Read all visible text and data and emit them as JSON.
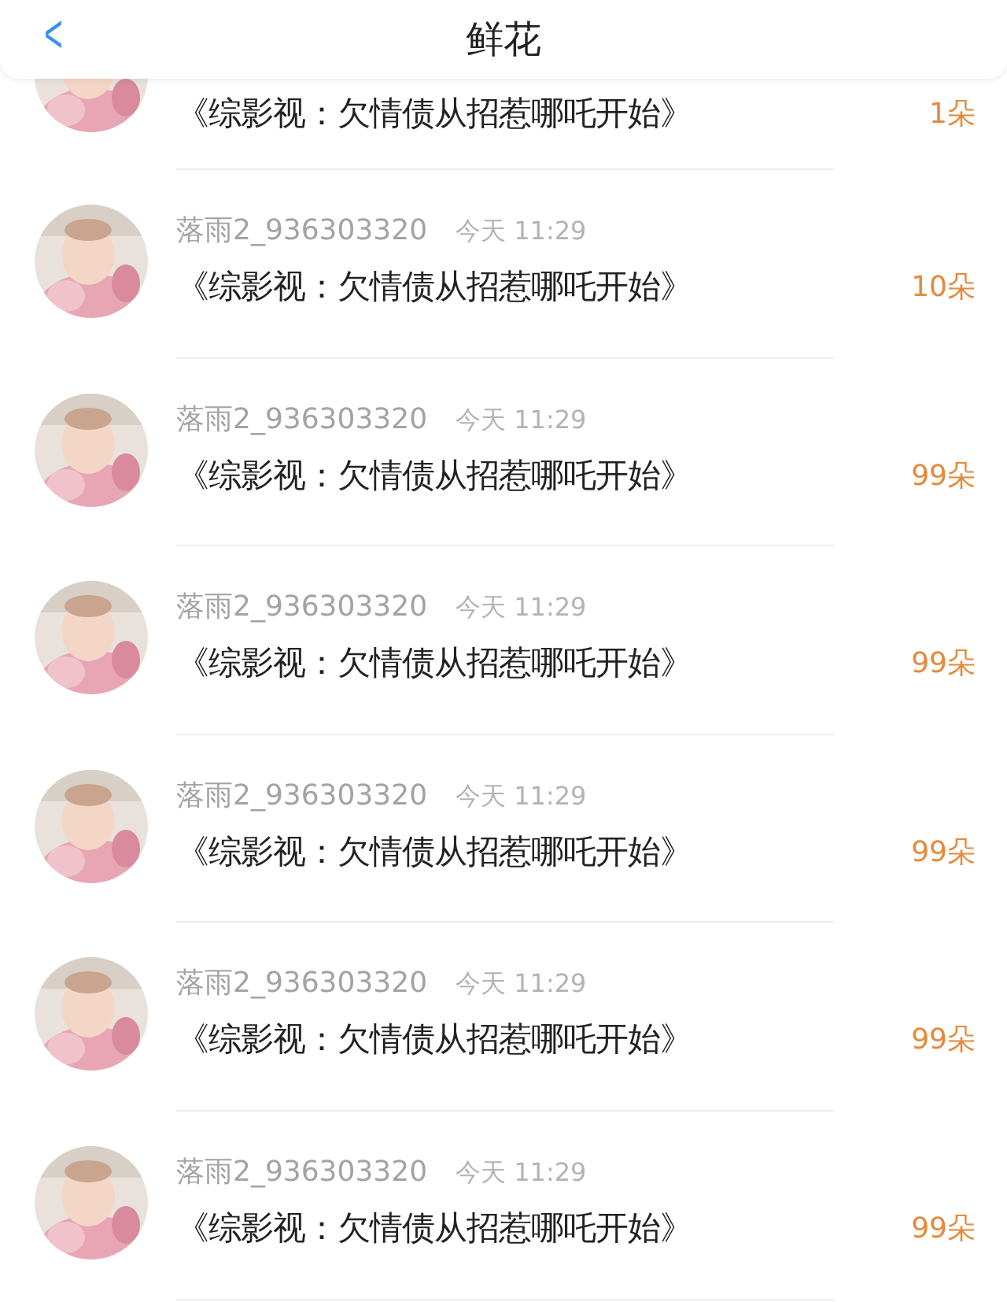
{
  "header": {
    "back": "<",
    "title": "鲜花"
  },
  "rows": [
    {
      "title": "《综影视：欠情债从招惹哪吒开始》",
      "count": "1朵"
    },
    {
      "name": "落雨2_936303320",
      "time": "今天 11:29",
      "title": "《综影视：欠情债从招惹哪吒开始》",
      "count": "10朵"
    },
    {
      "name": "落雨2_936303320",
      "time": "今天 11:29",
      "title": "《综影视：欠情债从招惹哪吒开始》",
      "count": "99朵"
    },
    {
      "name": "落雨2_936303320",
      "time": "今天 11:29",
      "title": "《综影视：欠情债从招惹哪吒开始》",
      "count": "99朵"
    },
    {
      "name": "落雨2_936303320",
      "time": "今天 11:29",
      "title": "《综影视：欠情债从招惹哪吒开始》",
      "count": "99朵"
    },
    {
      "name": "落雨2_936303320",
      "time": "今天 11:29",
      "title": "《综影视：欠情债从招惹哪吒开始》",
      "count": "99朵"
    },
    {
      "name": "落雨2_936303320",
      "time": "今天 11:29",
      "title": "《综影视：欠情债从招惹哪吒开始》",
      "count": "99朵"
    }
  ]
}
